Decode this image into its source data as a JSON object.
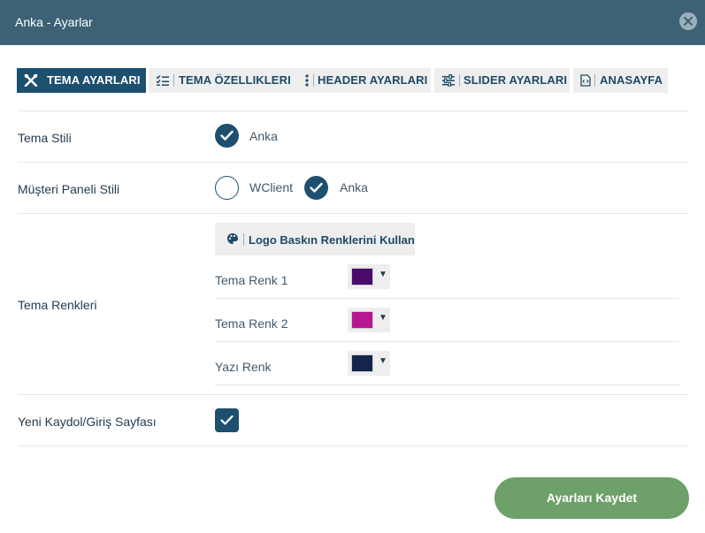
{
  "window": {
    "title": "Anka - Ayarlar",
    "close_icon": "close-icon"
  },
  "tabs": [
    {
      "label": "TEMA AYARLARI",
      "icon": "tools-icon",
      "active": true
    },
    {
      "label": "TEMA ÖZELLIKLERI",
      "icon": "list-check-icon",
      "active": false
    },
    {
      "label": "HEADER AYARLARI",
      "icon": "dots-vertical-icon",
      "active": false
    },
    {
      "label": "SLIDER AYARLARI",
      "icon": "sliders-icon",
      "active": false
    },
    {
      "label": "ANASAYFA",
      "icon": "file-code-icon",
      "active": false
    }
  ],
  "settings": {
    "tema_stili": {
      "label": "Tema Stili",
      "options": [
        {
          "label": "Anka",
          "checked": true
        }
      ]
    },
    "musteri_paneli": {
      "label": "Müşteri Paneli Stili",
      "options": [
        {
          "label": "WClient",
          "checked": false
        },
        {
          "label": "Anka",
          "checked": true
        }
      ]
    },
    "tema_renkleri": {
      "label": "Tema Renkleri",
      "logo_button": "Logo Baskın Renklerini Kullan",
      "colors": [
        {
          "label": "Tema Renk 1",
          "value": "#4a0a6e"
        },
        {
          "label": "Tema Renk 2",
          "value": "#b8168f"
        },
        {
          "label": "Yazı Renk",
          "value": "#13254a"
        }
      ]
    },
    "yeni_kaydol": {
      "label": "Yeni Kaydol/Giriş Sayfası",
      "checked": true
    }
  },
  "actions": {
    "save_label": "Ayarları Kaydet"
  },
  "colors": {
    "header_bg": "#3d6275",
    "primary": "#1d4f6f",
    "save_button": "#6ea06a"
  }
}
